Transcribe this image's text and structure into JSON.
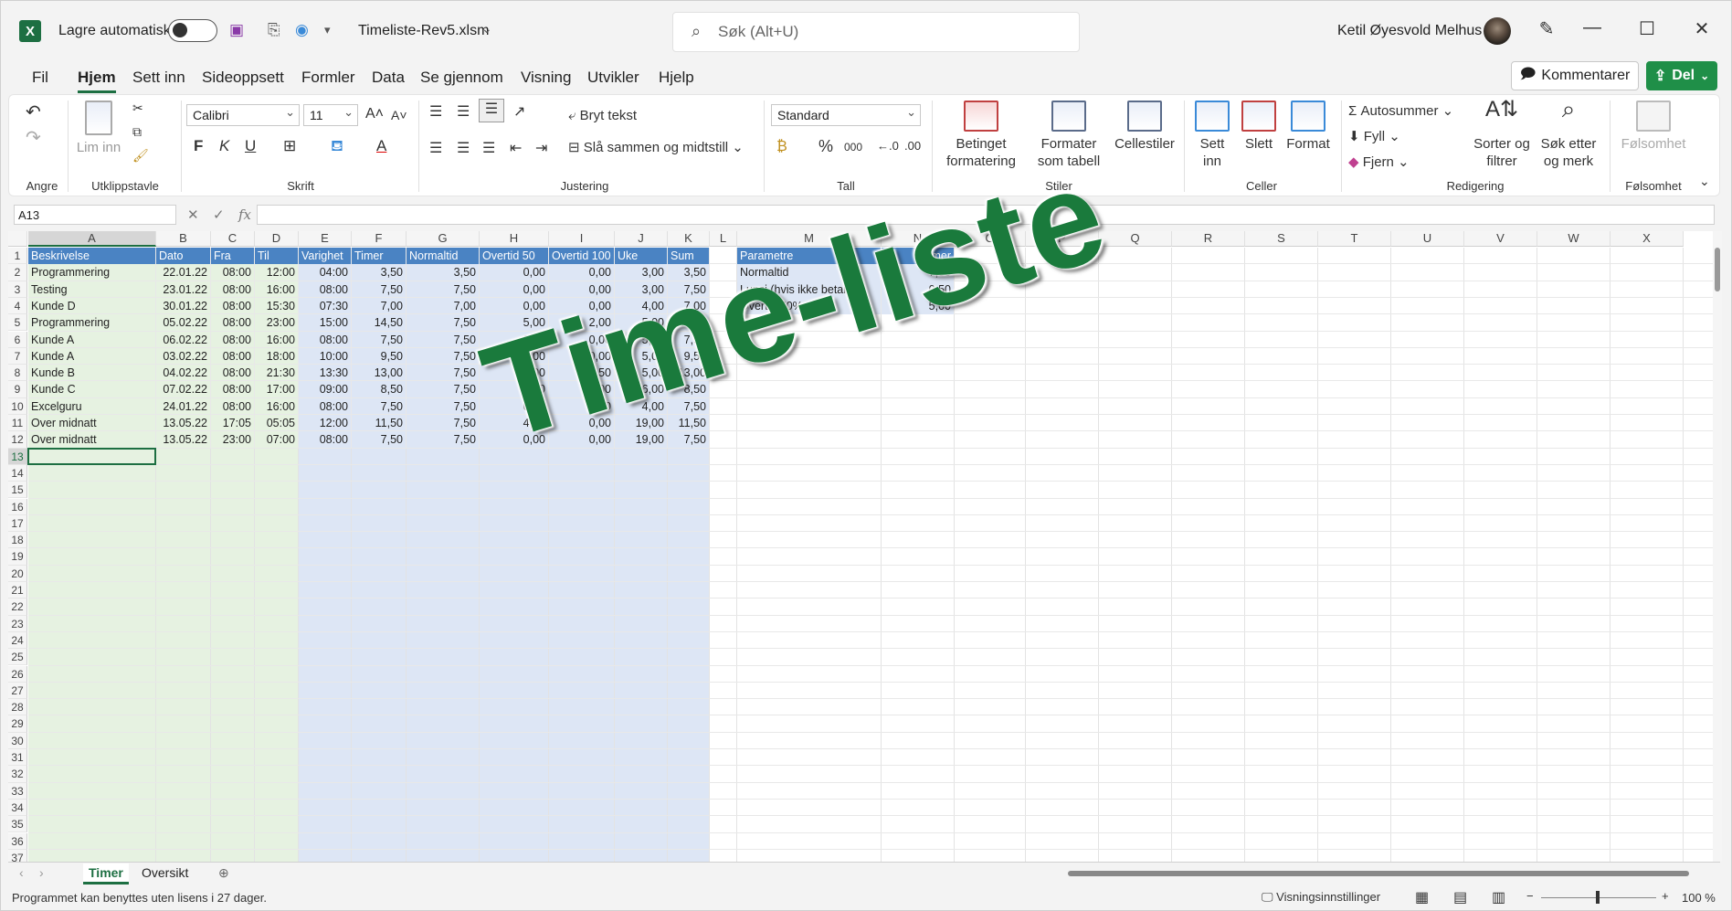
{
  "titlebar": {
    "autosave_label": "Lagre automatisk",
    "filename": "Timeliste-Rev5.xlsm",
    "search_placeholder": "Søk (Alt+U)",
    "user_name": "Ketil Øyesvold Melhus"
  },
  "menu": [
    "Fil",
    "Hjem",
    "Sett inn",
    "Sideoppsett",
    "Formler",
    "Data",
    "Se gjennom",
    "Visning",
    "Utvikler",
    "Hjelp"
  ],
  "menu_active": "Hjem",
  "buttons": {
    "comment": "Kommentarer",
    "share": "Del"
  },
  "ribbon": {
    "groups": {
      "undo": "Angre",
      "clipboard": "Utklippstavle",
      "font": "Skrift",
      "align": "Justering",
      "number": "Tall",
      "styles": "Stiler",
      "cells": "Celler",
      "editing": "Redigering",
      "sensitivity": "Følsomhet"
    },
    "paste": "Lim inn",
    "font_name": "Calibri",
    "font_size": "11",
    "bold": "F",
    "italic": "K",
    "underline": "U",
    "wrap_text": "Bryt tekst",
    "merge_center": "Slå sammen og midtstill",
    "number_format": "Standard",
    "percent": "%",
    "thousands": "000",
    "cond_format": "Betinget formatering",
    "format_table": "Formater som tabell",
    "cell_styles": "Cellestiler",
    "insert": "Sett inn",
    "delete": "Slett",
    "format": "Format",
    "autosum": "Autosummer",
    "fill": "Fyll",
    "clear": "Fjern",
    "sort_filter": "Sorter og filtrer",
    "find_select": "Søk etter og merk",
    "sensitivity": "Følsomhet"
  },
  "formula_bar": {
    "name_box": "A13",
    "fx": "fx"
  },
  "columns": [
    "A",
    "B",
    "C",
    "D",
    "E",
    "F",
    "G",
    "H",
    "I",
    "J",
    "K",
    "L",
    "M",
    "N",
    "O",
    "P",
    "Q",
    "R",
    "S",
    "T",
    "U",
    "V",
    "W",
    "X"
  ],
  "table_headers": [
    "Beskrivelse",
    "Dato",
    "Fra",
    "Til",
    "Varighet",
    "Timer",
    "Normaltid",
    "Overtid 50",
    "Overtid 100",
    "Uke",
    "Sum"
  ],
  "table_rows": [
    [
      "Programmering",
      "22.01.22",
      "08:00",
      "12:00",
      "04:00",
      "3,50",
      "3,50",
      "0,00",
      "0,00",
      "3,00",
      "3,50"
    ],
    [
      "Testing",
      "23.01.22",
      "08:00",
      "16:00",
      "08:00",
      "7,50",
      "7,50",
      "0,00",
      "0,00",
      "3,00",
      "7,50"
    ],
    [
      "Kunde D",
      "30.01.22",
      "08:00",
      "15:30",
      "07:30",
      "7,00",
      "7,00",
      "0,00",
      "0,00",
      "4,00",
      "7,00"
    ],
    [
      "Programmering",
      "05.02.22",
      "08:00",
      "23:00",
      "15:00",
      "14,50",
      "7,50",
      "5,00",
      "2,00",
      "5,00",
      "14,50"
    ],
    [
      "Kunde A",
      "06.02.22",
      "08:00",
      "16:00",
      "08:00",
      "7,50",
      "7,50",
      "0,00",
      "0,00",
      "5,00",
      "7,50"
    ],
    [
      "Kunde A",
      "03.02.22",
      "08:00",
      "18:00",
      "10:00",
      "9,50",
      "7,50",
      "2,00",
      "0,00",
      "5,00",
      "9,50"
    ],
    [
      "Kunde B",
      "04.02.22",
      "08:00",
      "21:30",
      "13:30",
      "13,00",
      "7,50",
      "5,00",
      "0,50",
      "5,00",
      "13,00"
    ],
    [
      "Kunde C",
      "07.02.22",
      "08:00",
      "17:00",
      "09:00",
      "8,50",
      "7,50",
      "1,00",
      "0,00",
      "6,00",
      "8,50"
    ],
    [
      "Excelguru",
      "24.01.22",
      "08:00",
      "16:00",
      "08:00",
      "7,50",
      "7,50",
      "0,00",
      "0,00",
      "4,00",
      "7,50"
    ],
    [
      "Over midnatt",
      "13.05.22",
      "17:05",
      "05:05",
      "12:00",
      "11,50",
      "7,50",
      "4,00",
      "0,00",
      "19,00",
      "11,50"
    ],
    [
      "Over midnatt",
      "13.05.22",
      "23:00",
      "07:00",
      "08:00",
      "7,50",
      "7,50",
      "0,00",
      "0,00",
      "19,00",
      "7,50"
    ]
  ],
  "param_headers": [
    "Parametre",
    "Timer"
  ],
  "param_rows": [
    [
      "Normaltid",
      "7,50"
    ],
    [
      "Lunsj (hvis ikke betalt)",
      "0,50"
    ],
    [
      "Overtid 50%",
      "5,00"
    ]
  ],
  "overlay_text": "Time-liste",
  "sheet_tabs": [
    "Timer",
    "Oversikt"
  ],
  "active_sheet": "Timer",
  "status": {
    "message": "Programmet kan benyttes uten lisens i 27 dager.",
    "view_settings": "Visningsinnstillinger",
    "zoom": "100 %"
  },
  "colors": {
    "excel_green": "#1d6f42",
    "header_blue": "#4a83c3",
    "band_green": "#e6f2e1",
    "band_blue": "#dde6f5"
  }
}
